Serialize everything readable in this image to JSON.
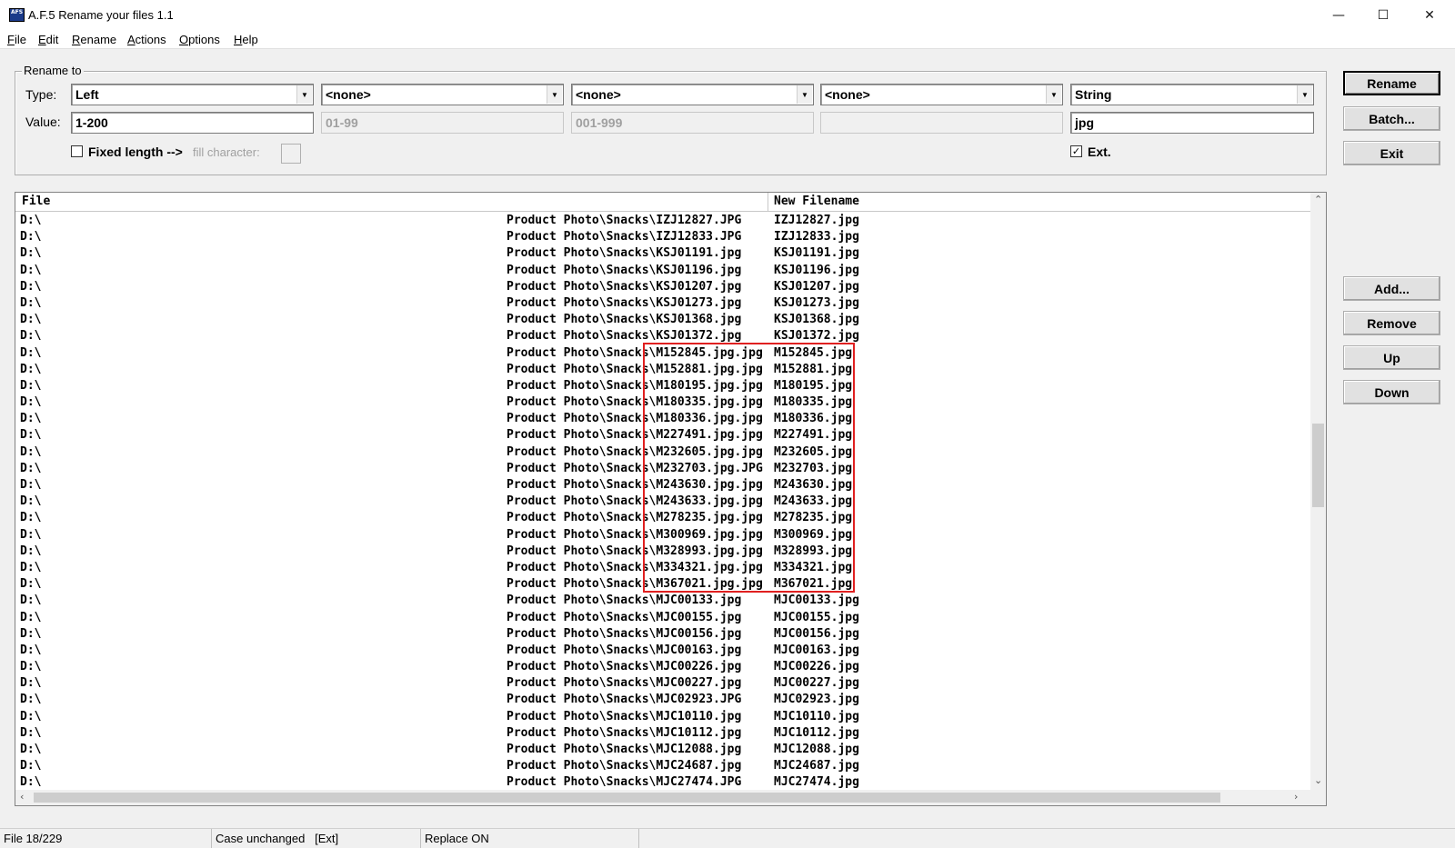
{
  "window": {
    "title": "A.F.5 Rename your files 1.1",
    "icon_text": "AFS"
  },
  "menu": [
    {
      "label": "File",
      "u": "F"
    },
    {
      "label": "Edit",
      "u": "E"
    },
    {
      "label": "Rename",
      "u": "R"
    },
    {
      "label": "Actions",
      "u": "A"
    },
    {
      "label": "Options",
      "u": "O"
    },
    {
      "label": "Help",
      "u": "H"
    }
  ],
  "rename_to": {
    "legend": "Rename to",
    "type_label": "Type:",
    "value_label": "Value:",
    "types": [
      "Left",
      "<none>",
      "<none>",
      "<none>",
      "String"
    ],
    "values": [
      "1-200",
      "01-99",
      "001-999",
      "",
      "jpg"
    ],
    "value_enabled": [
      true,
      false,
      false,
      false,
      true
    ],
    "fixed_length_label": "Fixed length -->",
    "fixed_length_checked": false,
    "fill_character_label": "fill character:",
    "ext_label": "Ext.",
    "ext_checked": true
  },
  "buttons": {
    "rename": "Rename",
    "batch": "Batch...",
    "exit": "Exit",
    "add": "Add...",
    "remove": "Remove",
    "up": "Up",
    "down": "Down"
  },
  "list": {
    "columns": {
      "file": "File",
      "new_filename": "New Filename"
    },
    "drive_prefix": "D:\\",
    "path_prefix": "Product Photo\\Snacks\\",
    "rows": [
      {
        "file": "IZJ12827.JPG",
        "new": "IZJ12827.jpg"
      },
      {
        "file": "IZJ12833.JPG",
        "new": "IZJ12833.jpg"
      },
      {
        "file": "KSJ01191.jpg",
        "new": "KSJ01191.jpg"
      },
      {
        "file": "KSJ01196.jpg",
        "new": "KSJ01196.jpg"
      },
      {
        "file": "KSJ01207.jpg",
        "new": "KSJ01207.jpg"
      },
      {
        "file": "KSJ01273.jpg",
        "new": "KSJ01273.jpg"
      },
      {
        "file": "KSJ01368.jpg",
        "new": "KSJ01368.jpg"
      },
      {
        "file": "KSJ01372.jpg",
        "new": "KSJ01372.jpg"
      },
      {
        "file": "M152845.jpg.jpg",
        "new": "M152845.jpg"
      },
      {
        "file": "M152881.jpg.jpg",
        "new": "M152881.jpg"
      },
      {
        "file": "M180195.jpg.jpg",
        "new": "M180195.jpg"
      },
      {
        "file": "M180335.jpg.jpg",
        "new": "M180335.jpg"
      },
      {
        "file": "M180336.jpg.jpg",
        "new": "M180336.jpg"
      },
      {
        "file": "M227491.jpg.jpg",
        "new": "M227491.jpg"
      },
      {
        "file": "M232605.jpg.jpg",
        "new": "M232605.jpg"
      },
      {
        "file": "M232703.jpg.JPG",
        "new": "M232703.jpg"
      },
      {
        "file": "M243630.jpg.jpg",
        "new": "M243630.jpg"
      },
      {
        "file": "M243633.jpg.jpg",
        "new": "M243633.jpg"
      },
      {
        "file": "M278235.jpg.jpg",
        "new": "M278235.jpg"
      },
      {
        "file": "M300969.jpg.jpg",
        "new": "M300969.jpg"
      },
      {
        "file": "M328993.jpg.jpg",
        "new": "M328993.jpg"
      },
      {
        "file": "M334321.jpg.jpg",
        "new": "M334321.jpg"
      },
      {
        "file": "M367021.jpg.jpg",
        "new": "M367021.jpg"
      },
      {
        "file": "MJC00133.jpg",
        "new": "MJC00133.jpg"
      },
      {
        "file": "MJC00155.jpg",
        "new": "MJC00155.jpg"
      },
      {
        "file": "MJC00156.jpg",
        "new": "MJC00156.jpg"
      },
      {
        "file": "MJC00163.jpg",
        "new": "MJC00163.jpg"
      },
      {
        "file": "MJC00226.jpg",
        "new": "MJC00226.jpg"
      },
      {
        "file": "MJC00227.jpg",
        "new": "MJC00227.jpg"
      },
      {
        "file": "MJC02923.JPG",
        "new": "MJC02923.jpg"
      },
      {
        "file": "MJC10110.jpg",
        "new": "MJC10110.jpg"
      },
      {
        "file": "MJC10112.jpg",
        "new": "MJC10112.jpg"
      },
      {
        "file": "MJC12088.jpg",
        "new": "MJC12088.jpg"
      },
      {
        "file": "MJC24687.jpg",
        "new": "MJC24687.jpg"
      },
      {
        "file": "MJC27474.JPG",
        "new": "MJC27474.jpg"
      }
    ]
  },
  "status": {
    "file_count": "File 18/229",
    "case": "Case unchanged   [Ext]",
    "replace": "Replace ON"
  },
  "colors": {
    "highlight": "#e02020",
    "window_bg": "#f0f0f0"
  }
}
